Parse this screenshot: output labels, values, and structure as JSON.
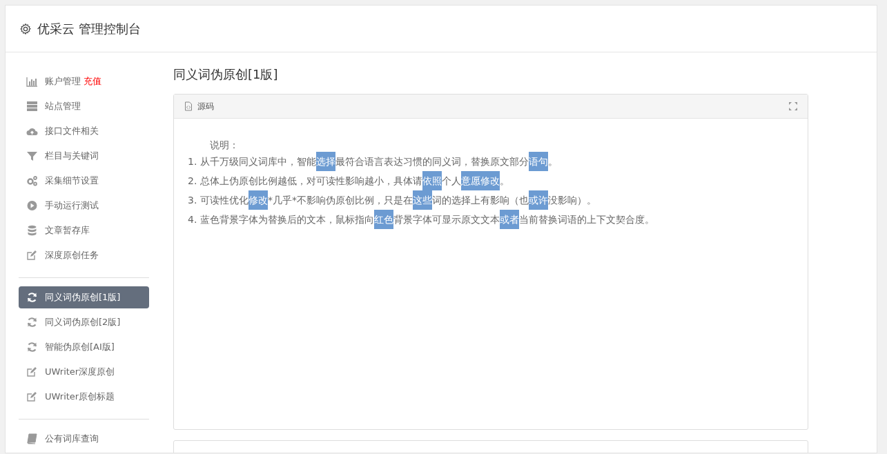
{
  "header": {
    "title": "优采云 管理控制台"
  },
  "sidebar": {
    "groups": [
      {
        "items": [
          {
            "label": "账户管理",
            "badge": "充值",
            "selected": false
          },
          {
            "label": "站点管理",
            "selected": false
          },
          {
            "label": "接口文件相关",
            "selected": false
          },
          {
            "label": "栏目与关键词",
            "selected": false
          },
          {
            "label": "采集细节设置",
            "selected": false
          },
          {
            "label": "手动运行测试",
            "selected": false
          },
          {
            "label": "文章暂存库",
            "selected": false
          },
          {
            "label": "深度原创任务",
            "selected": false
          }
        ]
      },
      {
        "items": [
          {
            "label": "同义词伪原创[1版]",
            "selected": true
          },
          {
            "label": "同义词伪原创[2版]",
            "selected": false
          },
          {
            "label": "智能伪原创[AI版]",
            "selected": false
          },
          {
            "label": "UWriter深度原创",
            "selected": false
          },
          {
            "label": "UWriter原创标题",
            "selected": false
          }
        ]
      },
      {
        "items": [
          {
            "label": "公有词库查询",
            "selected": false
          }
        ]
      }
    ]
  },
  "content": {
    "title": "同义词伪原创[1版]",
    "panel": {
      "tab": "源码",
      "intro": "说明：",
      "lines": [
        {
          "number": "1.",
          "segments": [
            {
              "text": "从千万级同义词库中，智能",
              "replaced": false
            },
            {
              "text": "选择",
              "replaced": true
            },
            {
              "text": "最符合语言表达习惯的同义词，替换原文部分",
              "replaced": false
            },
            {
              "text": "语句",
              "replaced": true
            },
            {
              "text": "。",
              "replaced": false
            }
          ]
        },
        {
          "number": "2.",
          "segments": [
            {
              "text": "总体上伪原创比例越低，对可读性影响越小，具体请",
              "replaced": false
            },
            {
              "text": "依照",
              "replaced": true
            },
            {
              "text": "个人",
              "replaced": false
            },
            {
              "text": "意愿",
              "replaced": true
            },
            {
              "text": "修改",
              "replaced": true
            },
            {
              "text": "。",
              "replaced": false
            }
          ]
        },
        {
          "number": "3.",
          "segments": [
            {
              "text": "可读性优化",
              "replaced": false
            },
            {
              "text": "修改",
              "replaced": true
            },
            {
              "text": "*几乎*不影响伪原创比例，只是在",
              "replaced": false
            },
            {
              "text": "这些",
              "replaced": true
            },
            {
              "text": "词的选择上有影响（也",
              "replaced": false
            },
            {
              "text": "或许",
              "replaced": true
            },
            {
              "text": "没影响）。",
              "replaced": false
            }
          ]
        },
        {
          "number": "4.",
          "segments": [
            {
              "text": "蓝色背景字体为替换后的文本，鼠标指向",
              "replaced": false
            },
            {
              "text": "红色",
              "replaced": true
            },
            {
              "text": "背景字体可显示原文文本",
              "replaced": false
            },
            {
              "text": "或者",
              "replaced": true
            },
            {
              "text": "当前替换词语的上下文契合度。",
              "replaced": false
            }
          ]
        }
      ]
    }
  }
}
